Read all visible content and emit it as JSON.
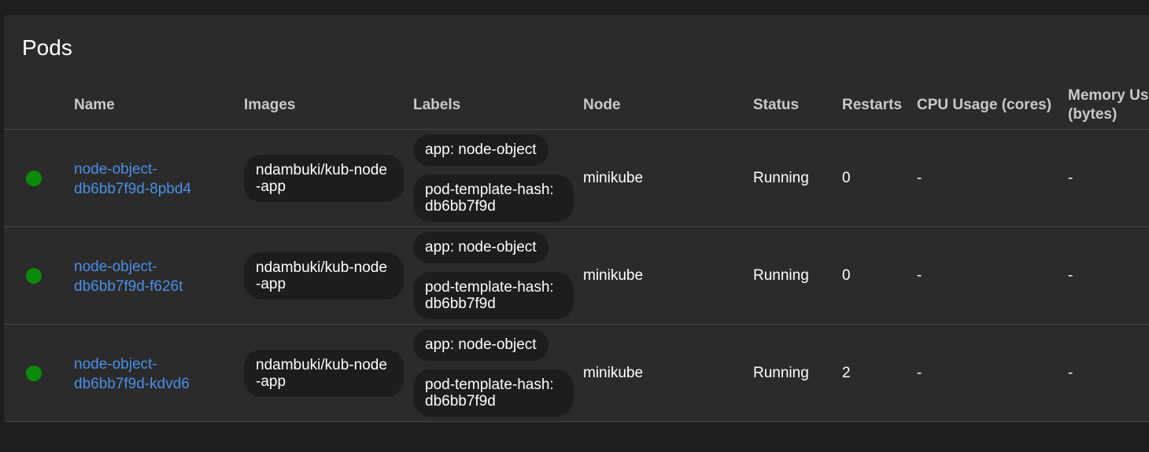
{
  "panel": {
    "title": "Pods"
  },
  "table": {
    "headers": {
      "name": "Name",
      "images": "Images",
      "labels": "Labels",
      "node": "Node",
      "status": "Status",
      "restarts": "Restarts",
      "cpu": "CPU Usage (cores)",
      "memory": "Memory Us\n(bytes)"
    },
    "rows": [
      {
        "status_color": "#0a8a0a",
        "name": "node-object-db6bb7f9d-8pbd4",
        "name_line1": "node-object-",
        "name_line2": "db6bb7f9d-8pbd4",
        "image": "ndambuki/kub-node-app",
        "label_app": "app: node-object",
        "label_hash": "pod-template-hash: db6bb7f9d",
        "node": "minikube",
        "status": "Running",
        "restarts": "0",
        "cpu": "-",
        "memory": "-"
      },
      {
        "status_color": "#0a8a0a",
        "name": "node-object-db6bb7f9d-f626t",
        "name_line1": "node-object-",
        "name_line2": "db6bb7f9d-f626t",
        "image": "ndambuki/kub-node-app",
        "label_app": "app: node-object",
        "label_hash": "pod-template-hash: db6bb7f9d",
        "node": "minikube",
        "status": "Running",
        "restarts": "0",
        "cpu": "-",
        "memory": "-"
      },
      {
        "status_color": "#0a8a0a",
        "name": "node-object-db6bb7f9d-kdvd6",
        "name_line1": "node-object-",
        "name_line2": "db6bb7f9d-kdvd6",
        "image": "ndambuki/kub-node-app",
        "label_app": "app: node-object",
        "label_hash": "pod-template-hash: db6bb7f9d",
        "node": "minikube",
        "status": "Running",
        "restarts": "2",
        "cpu": "-",
        "memory": "-"
      }
    ]
  }
}
